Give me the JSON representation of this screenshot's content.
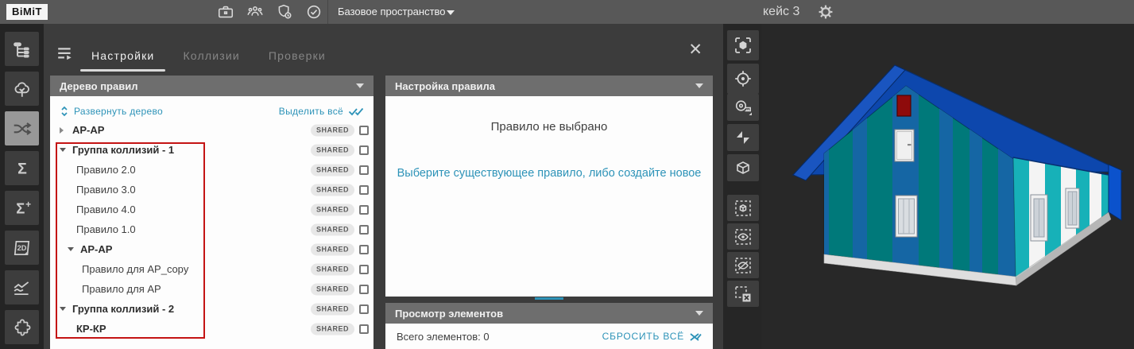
{
  "app": {
    "logo": "BiMiT",
    "workspace_selector": "Базовое пространство",
    "case_label": "кейс 3"
  },
  "icons": {
    "top": [
      "briefcase-icon",
      "users-icon",
      "shield-clock-icon",
      "check-circle-icon",
      "gear-icon"
    ],
    "sidebar": [
      "hierarchy-tree-icon",
      "cloud-tree-icon",
      "shuffle-icon",
      "sigma-icon",
      "sigma-plus-icon",
      "2d-view-icon",
      "trend-lines-icon",
      "puzzle-icon"
    ],
    "right_toolbar": [
      "focus-hexagon-icon",
      "target-icon",
      "tape-measure-icon",
      "section-plane-icon",
      "section-box-icon",
      "isolate-box-icon",
      "show-eye-icon",
      "hide-eye-icon",
      "clear-selection-icon"
    ],
    "panel": [
      "menu-arrow-icon",
      "close-icon",
      "collapse-caret-icon",
      "expand-tree-icon",
      "double-check-icon",
      "reset-cross-icon"
    ]
  },
  "tabs": {
    "settings": "Настройки",
    "collisions": "Коллизии",
    "checks": "Проверки"
  },
  "tree_panel": {
    "title": "Дерево правил",
    "expand_all": "Развернуть дерево",
    "select_all": "Выделить всё",
    "shared_badge": "SHARED",
    "rows": [
      {
        "label": "АР-АР",
        "level": 0,
        "bold": true,
        "expander": "collapsed",
        "shared": true
      },
      {
        "label": "Группа коллизий - 1",
        "level": 0,
        "bold": true,
        "expander": "expanded",
        "shared": true
      },
      {
        "label": "Правило 2.0",
        "level": 1,
        "bold": false,
        "expander": "none",
        "shared": true
      },
      {
        "label": "Правило 3.0",
        "level": 1,
        "bold": false,
        "expander": "none",
        "shared": true
      },
      {
        "label": "Правило 4.0",
        "level": 1,
        "bold": false,
        "expander": "none",
        "shared": true
      },
      {
        "label": "Правило 1.0",
        "level": 1,
        "bold": false,
        "expander": "none",
        "shared": true
      },
      {
        "label": "АР-АР",
        "level": 1,
        "bold": true,
        "expander": "expanded",
        "shared": true
      },
      {
        "label": "Правило для АР_copy",
        "level": 2,
        "bold": false,
        "expander": "none",
        "shared": true
      },
      {
        "label": "Правило для АР",
        "level": 2,
        "bold": false,
        "expander": "none",
        "shared": true
      },
      {
        "label": "Группа коллизий - 2",
        "level": 0,
        "bold": true,
        "expander": "expanded",
        "shared": true
      },
      {
        "label": "КР-КР",
        "level": 1,
        "bold": true,
        "expander": "none",
        "shared": true
      }
    ]
  },
  "rule_panel": {
    "title": "Настройка правила",
    "empty_title": "Правило не выбрано",
    "empty_hint": "Выберите существующее правило, либо создайте новое"
  },
  "elements_panel": {
    "title": "Просмотр элементов",
    "total_label": "Всего элементов: 0",
    "reset_link": "СБРОСИТЬ ВСЁ"
  },
  "colors": {
    "accent": "#2d93b8",
    "annotation_red": "#c41414",
    "roof": "#0d47ad",
    "roof_edge": "#1a55c0",
    "fascia_right": "#0b52cc",
    "wall_teal": "#00797a",
    "wall_blue": "#1566a4",
    "side_cyan": "#17b1b8",
    "side_white": "#f4f4f4",
    "red_window": "#8e0b0b",
    "base": "#dedede",
    "viewport_bg": "#282828"
  }
}
